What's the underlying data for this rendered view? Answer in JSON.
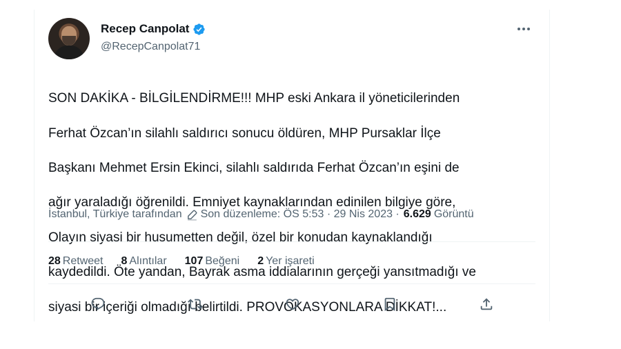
{
  "author": {
    "display_name": "Recep Canpolat",
    "handle": "@RecepCanpolat71",
    "verified_color": "#1d9bf0"
  },
  "tweet": {
    "text_lines": [
      "SON DAKİKA - BİLGİLENDİRME!!! MHP eski Ankara il yöneticilerinden",
      "Ferhat Özcan’ın silahlı saldırıcı sonucu öldüren, MHP Pursaklar İlçe",
      "Başkanı Mehmet Ersin Ekinci, silahlı saldırıda Ferhat Özcan’ın eşini de",
      "ağır yaraladığı öğrenildi. Emniyet kaynaklarından edinilen bilgiye göre,",
      "Olayın siyasi bir husumetten değil, özel bir konudan kaynaklandığı",
      "kaydedildi. Öte yandan, Bayrak asma iddialarının gerçeği yansıtmadığı ve",
      "siyasi bir içeriği olmadığı belirtildi. PROVOKASYONLARA DİKKAT!..."
    ]
  },
  "meta": {
    "location": "İstanbul, Türkiye tarafından",
    "edited": "Son düzenleme: ÖS 5:53 · 29 Nis 2023 ·",
    "views_count": "6.629",
    "views_label": "Görüntü"
  },
  "stats": {
    "retweets_count": "28",
    "retweets_label": "Retweet",
    "quotes_count": "8",
    "quotes_label": "Alıntılar",
    "likes_count": "107",
    "likes_label": "Beğeni",
    "bookmarks_count": "2",
    "bookmarks_label": "Yer işareti"
  },
  "icons": {
    "more": "more-icon",
    "reply": "reply-icon",
    "retweet": "retweet-icon",
    "like": "like-icon",
    "bookmark": "bookmark-icon",
    "share": "share-icon",
    "edit": "pencil-icon"
  },
  "colors": {
    "text": "#0f1419",
    "secondary": "#536471",
    "border": "#eff3f4",
    "icon": "#536471"
  }
}
